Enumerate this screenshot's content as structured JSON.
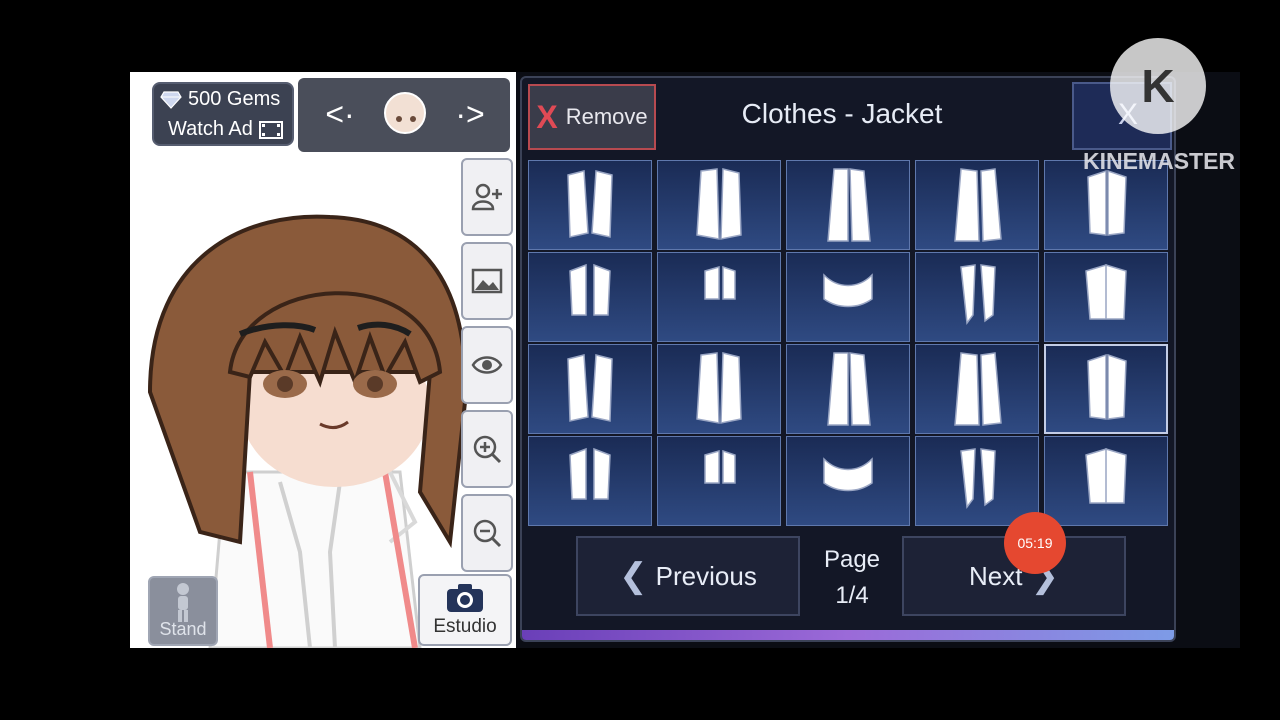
{
  "colors": {
    "panel_bg": "#131726",
    "accent_red": "#e04a55",
    "badge_orange": "#e54830",
    "cell_top": "#1a2b55",
    "cell_bottom": "#2f4a82"
  },
  "currency": {
    "gems_label": "500 Gems",
    "watch_ad_label": "Watch Ad",
    "gem_icon": "diamond-icon",
    "ad_icon": "film-icon"
  },
  "character_nav": {
    "prev_icon": "chevron-left-icon",
    "next_icon": "chevron-right-icon",
    "prev_glyph": "<·",
    "next_glyph": "·>"
  },
  "side_tools": [
    {
      "name": "add-character-tool",
      "icon": "add-person-icon"
    },
    {
      "name": "background-tool",
      "icon": "image-icon"
    },
    {
      "name": "visibility-tool",
      "icon": "eye-icon"
    },
    {
      "name": "zoom-in-tool",
      "icon": "zoom-in-icon"
    },
    {
      "name": "zoom-out-tool",
      "icon": "zoom-out-icon"
    }
  ],
  "bottom_left": {
    "stand_label": "Stand",
    "estudio_label": "Estudio"
  },
  "panel": {
    "remove_x": "X",
    "remove_label": "Remove",
    "title": "Clothes - Jacket",
    "close_label": "X",
    "jacket_items": [
      "jacket-1",
      "jacket-2",
      "jacket-3",
      "jacket-4",
      "jacket-5",
      "jacket-6",
      "jacket-7",
      "jacket-8",
      "jacket-9",
      "jacket-10",
      "jacket-11",
      "jacket-12",
      "jacket-13",
      "jacket-14",
      "jacket-15",
      "jacket-16",
      "jacket-17",
      "jacket-18",
      "jacket-19",
      "jacket-20"
    ],
    "selected_index": 14,
    "previous_label": "Previous",
    "next_label": "Next",
    "page_label": "Page",
    "page_value": "1/4"
  },
  "overlay": {
    "timer": "05:19",
    "watermark": "KINEMASTER",
    "watermark_letter": "K"
  }
}
